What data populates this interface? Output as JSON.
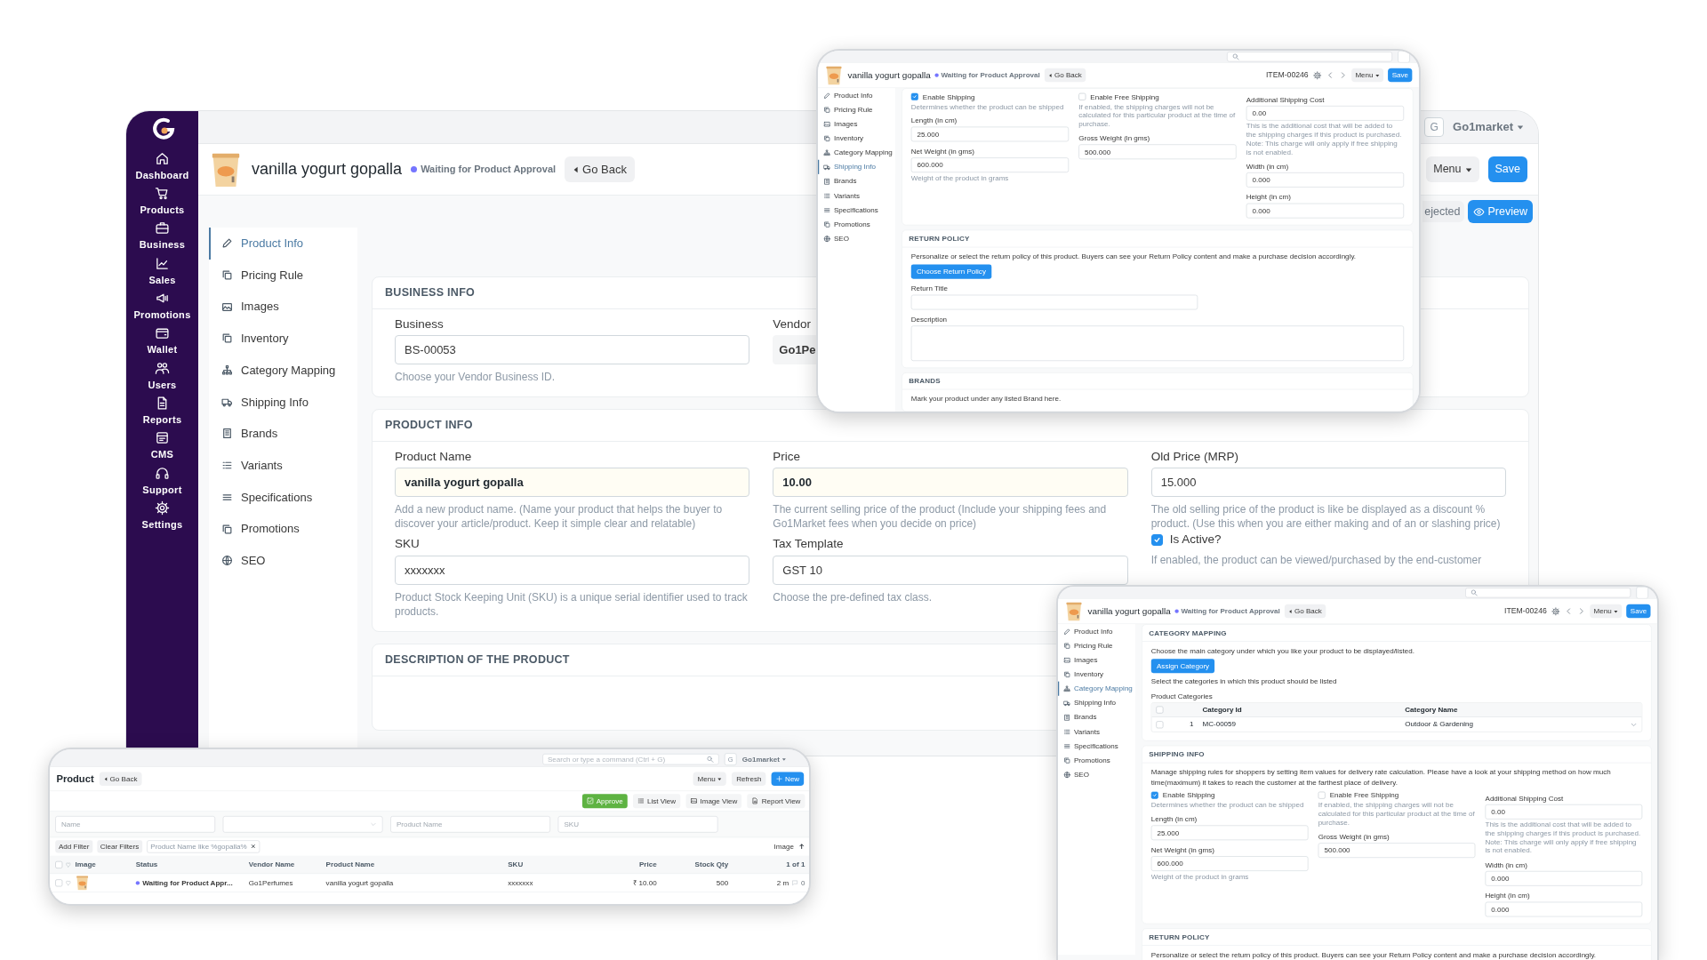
{
  "main_window": {
    "nav": [
      "Dashboard",
      "Products",
      "Business",
      "Sales",
      "Promotions",
      "Wallet",
      "Users",
      "Reports",
      "CMS",
      "Support",
      "Settings"
    ],
    "account": {
      "avatar": "G",
      "name": "Go1market"
    },
    "header": {
      "title": "vanilla yogurt gopalla",
      "status": "Waiting for Product Approval",
      "back": "Go Back",
      "buttons": [
        {
          "label": "Menu",
          "kind": "dropdown"
        },
        {
          "label": "Save",
          "kind": "primary"
        }
      ]
    },
    "subbar": {
      "status": "ejected",
      "action": "Preview"
    },
    "tabs": [
      {
        "label": "Product Info",
        "selected": true
      },
      {
        "label": "Pricing Rule",
        "selected": false
      },
      {
        "label": "Images",
        "selected": false
      },
      {
        "label": "Inventory",
        "selected": false
      },
      {
        "label": "Category Mapping",
        "selected": false
      },
      {
        "label": "Shipping Info",
        "selected": false
      },
      {
        "label": "Brands",
        "selected": false
      },
      {
        "label": "Variants",
        "selected": false
      },
      {
        "label": "Specifications",
        "selected": false
      },
      {
        "label": "Promotions",
        "selected": false
      },
      {
        "label": "SEO",
        "selected": false
      }
    ],
    "sections": [
      {
        "title": "BUSINESS INFO",
        "blocks": [
          {
            "kind": "columns",
            "columns": [
              [
                {
                  "kind": "field",
                  "label": "Business",
                  "value": "BS-00053",
                  "hint": "Choose your Vendor Business ID."
                }
              ],
              [
                {
                  "kind": "readonly-field",
                  "label": "Vendor",
                  "value": "Go1Pe"
                }
              ]
            ]
          }
        ]
      },
      {
        "title": "PRODUCT INFO",
        "blocks": [
          {
            "kind": "columns",
            "columns": [
              [
                {
                  "kind": "required-field",
                  "label": "Product Name",
                  "value": "vanilla yogurt gopalla",
                  "hint": "Add a new product name. (Name your product that helps the buyer to discover your article/product. Keep it simple clear and relatable)"
                },
                {
                  "kind": "field",
                  "label": "SKU",
                  "value": "xxxxxxx",
                  "hint": "Product Stock Keeping Unit (SKU) is a unique serial identifier used to track products."
                }
              ],
              [
                {
                  "kind": "required-field",
                  "label": "Price",
                  "value": "10.00",
                  "hint": "The current selling price of the product (Include your shipping fees and Go1Market fees when you decide on price)"
                },
                {
                  "kind": "field",
                  "label": "Tax Template",
                  "value": "GST 10",
                  "hint": "Choose the pre-defined tax class."
                }
              ],
              [
                {
                  "kind": "field",
                  "label": "Old Price (MRP)",
                  "value": "15.000",
                  "hint": "The old selling price of the product is like be displayed as a discount % product. (Use this when you are either making and of an or slashing price)"
                },
                {
                  "kind": "check",
                  "label": "Is Active?",
                  "checked": true,
                  "hint": "If enabled, the product can be viewed/purchased by the end-customer"
                }
              ]
            ]
          }
        ]
      },
      {
        "title": "DESCRIPTION OF THE PRODUCT"
      }
    ]
  },
  "windows": [
    {
      "kind": "form",
      "header": {
        "title": "vanilla yogurt gopalla",
        "status": "Waiting for Product Approval",
        "back": "Go Back",
        "item_id": "ITEM-00246",
        "buttons": [
          {
            "label": "Menu",
            "kind": "dropdown"
          },
          {
            "label": "Save",
            "kind": "primary"
          }
        ]
      },
      "tabs": [
        {
          "label": "Product Info",
          "selected": false
        },
        {
          "label": "Pricing Rule",
          "selected": false
        },
        {
          "label": "Images",
          "selected": false
        },
        {
          "label": "Inventory",
          "selected": false
        },
        {
          "label": "Category Mapping",
          "selected": false
        },
        {
          "label": "Shipping Info",
          "selected": true
        },
        {
          "label": "Brands",
          "selected": false
        },
        {
          "label": "Variants",
          "selected": false
        },
        {
          "label": "Specifications",
          "selected": false
        },
        {
          "label": "Promotions",
          "selected": false
        },
        {
          "label": "SEO",
          "selected": false
        }
      ],
      "sections": [
        {
          "blocks": [
            {
              "kind": "columns",
              "columns": [
                [
                  {
                    "kind": "check",
                    "label": "Enable Shipping",
                    "checked": true,
                    "hint": "Determines whether the product can be shipped"
                  },
                  {
                    "kind": "field",
                    "label": "Length (in cm)",
                    "value": "25.000"
                  },
                  {
                    "kind": "field",
                    "label": "Net Weight (in gms)",
                    "value": "600.000",
                    "hint": "Weight of the product in grams"
                  }
                ],
                [
                  {
                    "kind": "check",
                    "label": "Enable Free Shipping",
                    "checked": false,
                    "hint": "If enabled, the shipping charges will not be calculated for this particular product at the time of purchase."
                  },
                  {
                    "kind": "field",
                    "label": "Gross Weight (in gms)",
                    "value": "500.000"
                  }
                ],
                [
                  {
                    "kind": "field",
                    "label": "Additional Shipping Cost",
                    "value": "0.00",
                    "hint": "This is the additional cost that will be added to the shipping charges if this product is purchased. Note: This charge will only apply if free shipping is not enabled."
                  },
                  {
                    "kind": "field",
                    "label": "Width (in cm)",
                    "value": "0.000"
                  },
                  {
                    "kind": "field",
                    "label": "Height (in cm)",
                    "value": "0.000"
                  }
                ]
              ]
            }
          ]
        },
        {
          "title": "RETURN POLICY",
          "blocks": [
            {
              "kind": "text",
              "text": "Personalize or select the return policy of this product. Buyers can see your Return Policy content and make a purchase decision accordingly."
            },
            {
              "kind": "button",
              "label": "Choose Return Policy"
            },
            {
              "kind": "field",
              "label": "Return Title"
            },
            {
              "kind": "textarea",
              "label": "Description"
            }
          ]
        },
        {
          "title": "BRANDS",
          "blocks": [
            {
              "kind": "text",
              "text": "Mark your product under any listed Brand here."
            }
          ]
        }
      ]
    },
    {
      "kind": "form",
      "header": {
        "title": "vanilla yogurt gopalla",
        "status": "Waiting for Product Approval",
        "back": "Go Back",
        "item_id": "ITEM-00246",
        "buttons": [
          {
            "label": "Menu",
            "kind": "dropdown"
          },
          {
            "label": "Save",
            "kind": "primary"
          }
        ]
      },
      "tabs": [
        {
          "label": "Product Info",
          "selected": false
        },
        {
          "label": "Pricing Rule",
          "selected": false
        },
        {
          "label": "Images",
          "selected": false
        },
        {
          "label": "Inventory",
          "selected": false
        },
        {
          "label": "Category Mapping",
          "selected": true
        },
        {
          "label": "Shipping Info",
          "selected": false
        },
        {
          "label": "Brands",
          "selected": false
        },
        {
          "label": "Variants",
          "selected": false
        },
        {
          "label": "Specifications",
          "selected": false
        },
        {
          "label": "Promotions",
          "selected": false
        },
        {
          "label": "SEO",
          "selected": false
        }
      ],
      "sections": [
        {
          "title": "CATEGORY MAPPING",
          "blocks": [
            {
              "kind": "text",
              "text": "Choose the main category under which you like your product to be displayed/listed."
            },
            {
              "kind": "button",
              "label": "Assign Category"
            },
            {
              "kind": "text",
              "text": "Select the categories in which this product should be listed"
            },
            {
              "kind": "label",
              "text": "Product Categories"
            },
            {
              "kind": "table",
              "all_checked": false,
              "columns": [
                "Category Id",
                "Category Name"
              ],
              "rows": [
                {
                  "checked": false,
                  "index": "1",
                  "cells": [
                    "MC-00059",
                    "Outdoor & Gardening"
                  ]
                }
              ]
            }
          ]
        },
        {
          "title": "SHIPPING INFO",
          "blocks": [
            {
              "kind": "text",
              "text": "Manage shipping rules for shoppers by setting item values for delivery rate calculation. Please have a look at your shipping method on how much time(maximum) it takes to reach the customer at the farthest place of delivery."
            },
            {
              "kind": "columns",
              "columns": [
                [
                  {
                    "kind": "check",
                    "label": "Enable Shipping",
                    "checked": true,
                    "hint": "Determines whether the product can be shipped"
                  },
                  {
                    "kind": "field",
                    "label": "Length (in cm)",
                    "value": "25.000"
                  },
                  {
                    "kind": "field",
                    "label": "Net Weight (in gms)",
                    "value": "600.000",
                    "hint": "Weight of the product in grams"
                  }
                ],
                [
                  {
                    "kind": "check",
                    "label": "Enable Free Shipping",
                    "checked": false,
                    "hint": "If enabled, the shipping charges will not be calculated for this particular product at the time of purchase."
                  },
                  {
                    "kind": "field",
                    "label": "Gross Weight (in gms)",
                    "value": "500.000"
                  }
                ],
                [
                  {
                    "kind": "field",
                    "label": "Additional Shipping Cost",
                    "value": "0.00",
                    "hint": "This is the additional cost that will be added to the shipping charges if this product is purchased. Note: This charge will only apply if free shipping is not enabled."
                  },
                  {
                    "kind": "field",
                    "label": "Width (in cm)",
                    "value": "0.000"
                  },
                  {
                    "kind": "field",
                    "label": "Height (in cm)",
                    "value": "0.000"
                  }
                ]
              ]
            }
          ]
        },
        {
          "title": "RETURN POLICY",
          "blocks": [
            {
              "kind": "text",
              "text": "Personalize or select the return policy of this product. Buyers can see your Return Policy content and make a purchase decision accordingly."
            }
          ]
        }
      ]
    },
    {
      "kind": "list",
      "search_placeholder": "Search or type a command (Ctrl + G)",
      "account": {
        "avatar": "G",
        "name": "Go1market"
      },
      "title": "Product",
      "back": "Go Back",
      "buttons": [
        {
          "label": "Menu",
          "kind": "dropdown"
        },
        {
          "label": "Refresh",
          "kind": "secondary"
        },
        {
          "label": "New",
          "kind": "add"
        }
      ],
      "views": [
        {
          "label": "Approve",
          "kind": "approve"
        },
        {
          "label": "List View",
          "kind": "list"
        },
        {
          "label": "Image View",
          "kind": "image"
        },
        {
          "label": "Report View",
          "kind": "report"
        }
      ],
      "filters": [
        {
          "kind": "text",
          "placeholder": "Name"
        },
        {
          "kind": "select"
        },
        {
          "kind": "text",
          "placeholder": "Product Name"
        },
        {
          "kind": "text",
          "placeholder": "SKU"
        }
      ],
      "filter_actions": [
        "Add Filter",
        "Clear Filters"
      ],
      "filter_tags": [
        "Product Name like %gopalla%"
      ],
      "sort": "Image",
      "table": {
        "all_checked": false,
        "columns": [
          "Image",
          "Status",
          "Vendor Name",
          "Product Name",
          "SKU",
          "Price",
          "Stock Qty",
          "1 of 1"
        ],
        "rows": [
          {
            "checked": false,
            "status": "Waiting for Product Appr...",
            "vendor": "Go1Perfumes",
            "product": "vanilla yogurt gopalla",
            "sku": "xxxxxxx",
            "price": "₹ 10.00",
            "qty": "500",
            "modified": "2 m",
            "comments": "0"
          }
        ]
      }
    }
  ]
}
